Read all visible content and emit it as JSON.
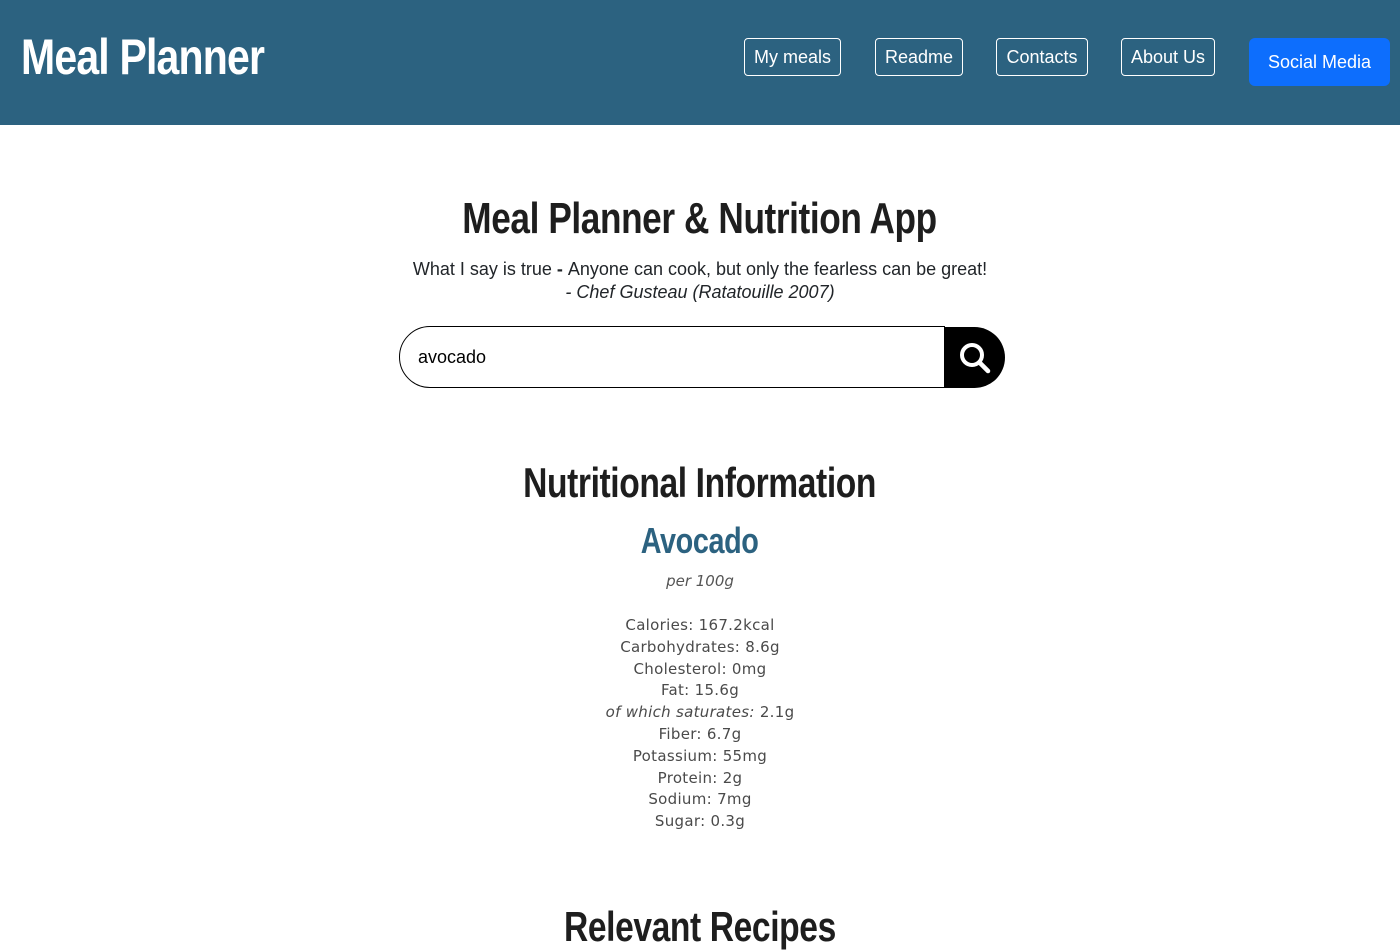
{
  "navbar": {
    "brand": "Meal Planner",
    "links": [
      "My meals",
      "Readme",
      "Contacts",
      "About Us"
    ],
    "social": "Social Media",
    "bg_color": "#2c6280"
  },
  "hero": {
    "title": "Meal Planner & Nutrition App",
    "quote_prefix": "What I say is true ",
    "quote_dash": "- ",
    "quote_text": "Anyone can cook, but only the fearless can be great!",
    "quote_author": "- Chef Gusteau (Ratatouille 2007)"
  },
  "search": {
    "value": "avocado",
    "icon": "search-icon"
  },
  "nutrition": {
    "heading": "Nutritional Information",
    "food": "Avocado",
    "per": "per 100g",
    "facts": [
      {
        "label": "Calories: ",
        "value": "167.2kcal"
      },
      {
        "label": "Carbohydrates: ",
        "value": "8.6g"
      },
      {
        "label": "Cholesterol: ",
        "value": "0mg"
      },
      {
        "label": "Fat: ",
        "value": "15.6g"
      },
      {
        "label": "of which saturates: ",
        "value": "2.1g",
        "italic": true
      },
      {
        "label": "Fiber: ",
        "value": "6.7g"
      },
      {
        "label": "Potassium: ",
        "value": "55mg"
      },
      {
        "label": "Protein: ",
        "value": "2g"
      },
      {
        "label": "Sodium: ",
        "value": "7mg"
      },
      {
        "label": "Sugar: ",
        "value": "0.3g"
      }
    ]
  },
  "recipes": {
    "heading": "Relevant Recipes"
  }
}
